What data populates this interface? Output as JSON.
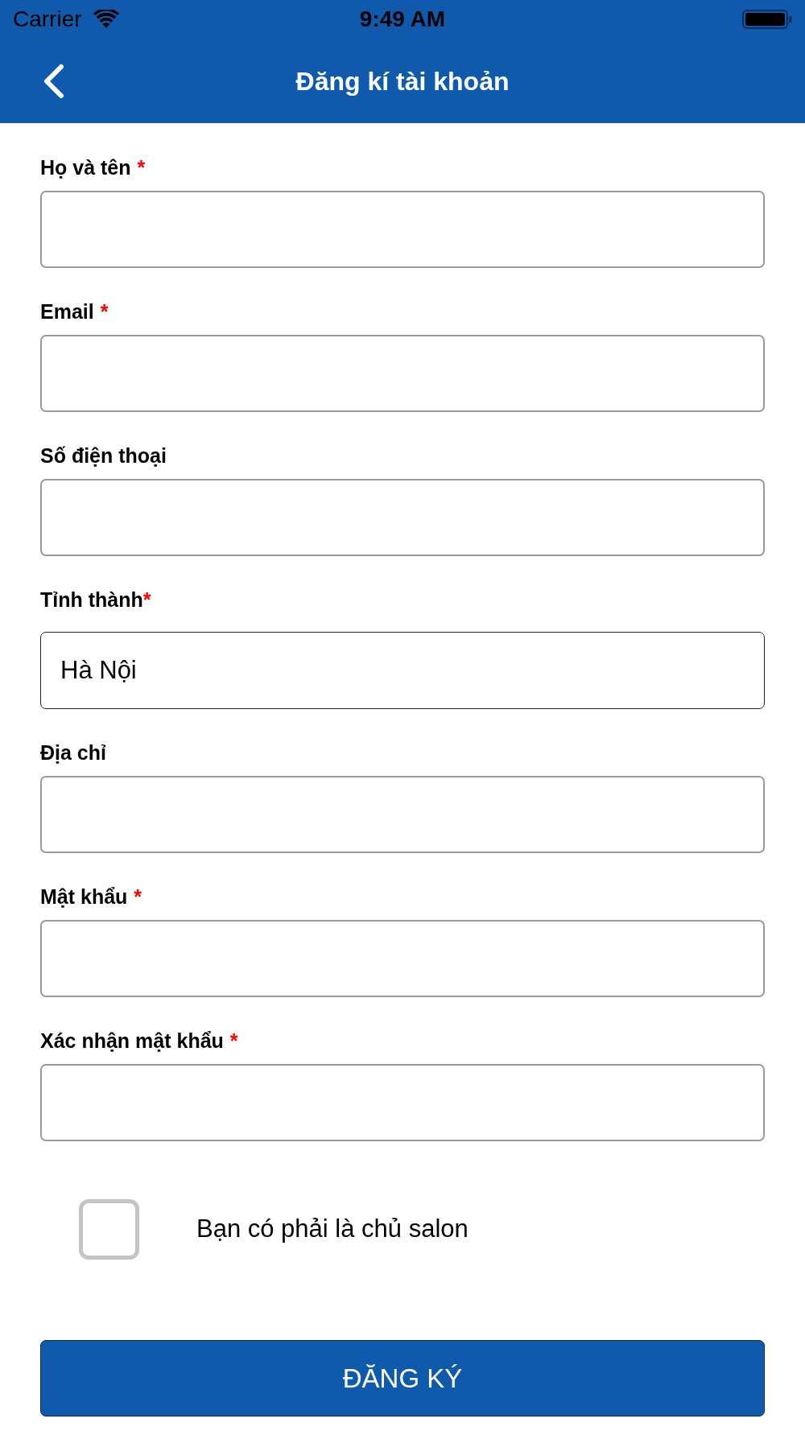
{
  "status_bar": {
    "carrier": "Carrier",
    "time": "9:49 AM"
  },
  "header": {
    "title": "Đăng kí tài khoản"
  },
  "fields": [
    {
      "kind": "text",
      "label": "Họ và tên",
      "required_mark": "*"
    },
    {
      "kind": "text",
      "label": "Email",
      "required_mark": "*"
    },
    {
      "kind": "text",
      "label": "Số điện thoại"
    },
    {
      "kind": "picker",
      "label": "Tỉnh thành",
      "required_mark": "*",
      "value": "Hà Nội"
    },
    {
      "kind": "text",
      "label": "Địa chỉ"
    },
    {
      "kind": "text",
      "label": "Mật khẩu",
      "required_mark": "*"
    },
    {
      "kind": "text",
      "label": "Xác nhận mật khẩu",
      "required_mark": "*"
    }
  ],
  "salon_owner": {
    "label": "Bạn có phải là chủ salon",
    "checked": false
  },
  "submit_button": {
    "label": "ĐĂNG KÝ"
  }
}
